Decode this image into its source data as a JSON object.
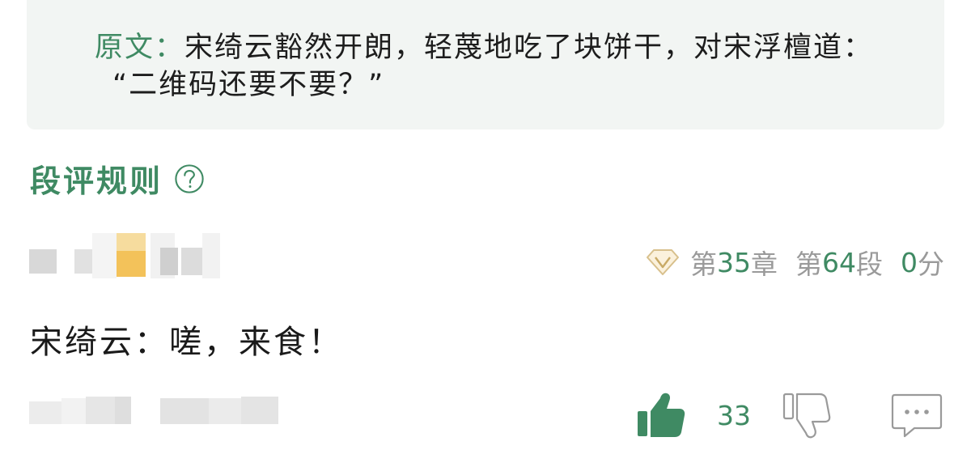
{
  "quote": {
    "label": "原文：",
    "line1": "宋绮云豁然开朗，轻蔑地吃了块饼干，对宋浮檀道：",
    "line2": "“二维码还要不要？”"
  },
  "rules": {
    "label": "段评规则"
  },
  "comment": {
    "meta": {
      "chapter_prefix": "第",
      "chapter_num": "35",
      "chapter_suffix": "章",
      "para_prefix": "第",
      "para_num": "64",
      "para_suffix": "段",
      "score_num": "0",
      "score_suffix": "分"
    },
    "text": "宋绮云：嗟，来食！",
    "likes": "33"
  },
  "colors": {
    "accent": "#3f8a63",
    "muted": "#9a9a9a",
    "quote_bg": "#f2f5f3"
  },
  "icons": [
    "help-icon",
    "diamond-icon",
    "thumbs-up-icon",
    "thumbs-down-icon",
    "reply-icon"
  ]
}
